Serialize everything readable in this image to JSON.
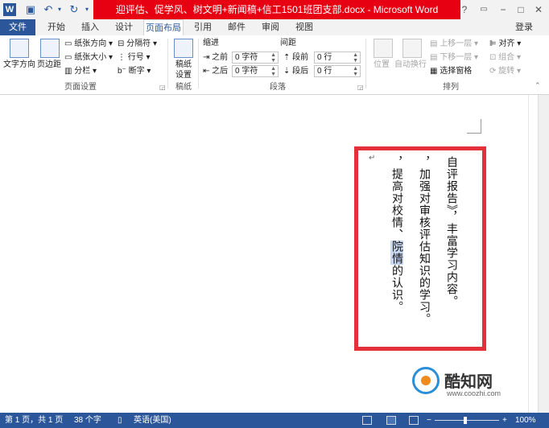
{
  "titlebar": {
    "app_icon": "word-icon",
    "title": "迎评估、促学风、树文明+新闻稿+信工1501班团支部.docx - Microsoft Word",
    "help": "?",
    "restore_icon": "ribbon-display-icon",
    "minimize": "−",
    "maximize": "□",
    "close": "✕"
  },
  "tabs": {
    "items": [
      "文件",
      "开始",
      "插入",
      "设计",
      "页面布局",
      "引用",
      "邮件",
      "审阅",
      "视图"
    ],
    "active": "页面布局",
    "signin": "登录"
  },
  "ribbon": {
    "page_setup": {
      "text_direction": "文字方向",
      "margins": "页边距",
      "orientation": "纸张方向",
      "size": "纸张大小",
      "columns": "分栏",
      "breaks": "分隔符",
      "line_numbers": "行号",
      "hyphenation": "断字",
      "label": "页面设置"
    },
    "manuscript": {
      "button": "稿纸设置",
      "label": "稿纸"
    },
    "paragraph": {
      "indent_header": "缩进",
      "spacing_header": "间距",
      "before_indent_label": "之前",
      "before_indent_value": "0 字符",
      "after_indent_label": "之后",
      "after_indent_value": "0 字符",
      "space_before_label": "段前",
      "space_before_value": "0 行",
      "space_after_label": "段后",
      "space_after_value": "0 行",
      "label": "段落"
    },
    "arrange": {
      "position": "位置",
      "wrap_text": "自动换行",
      "bring_forward": "上移一层",
      "send_backward": "下移一层",
      "selection_pane": "选择窗格",
      "align": "对齐",
      "group": "组合",
      "rotate": "旋转",
      "label": "排列"
    }
  },
  "document": {
    "columns": [
      {
        "text": "自评报告》，丰富学习内容。",
        "highlight": ""
      },
      {
        "text": "，加强对审核评估知识的学习。",
        "highlight": ""
      },
      {
        "text_before": "，提高对校情、",
        "highlight": "院情",
        "text_after": "的认识。"
      }
    ]
  },
  "watermark": {
    "name": "酷知网",
    "url": "www.coozhi.com"
  },
  "statusbar": {
    "page": "第 1 页，共 1 页",
    "words": "38 个字",
    "language": "英语(美国)",
    "zoom_minus": "−",
    "zoom_plus": "+",
    "zoom": "100%"
  }
}
